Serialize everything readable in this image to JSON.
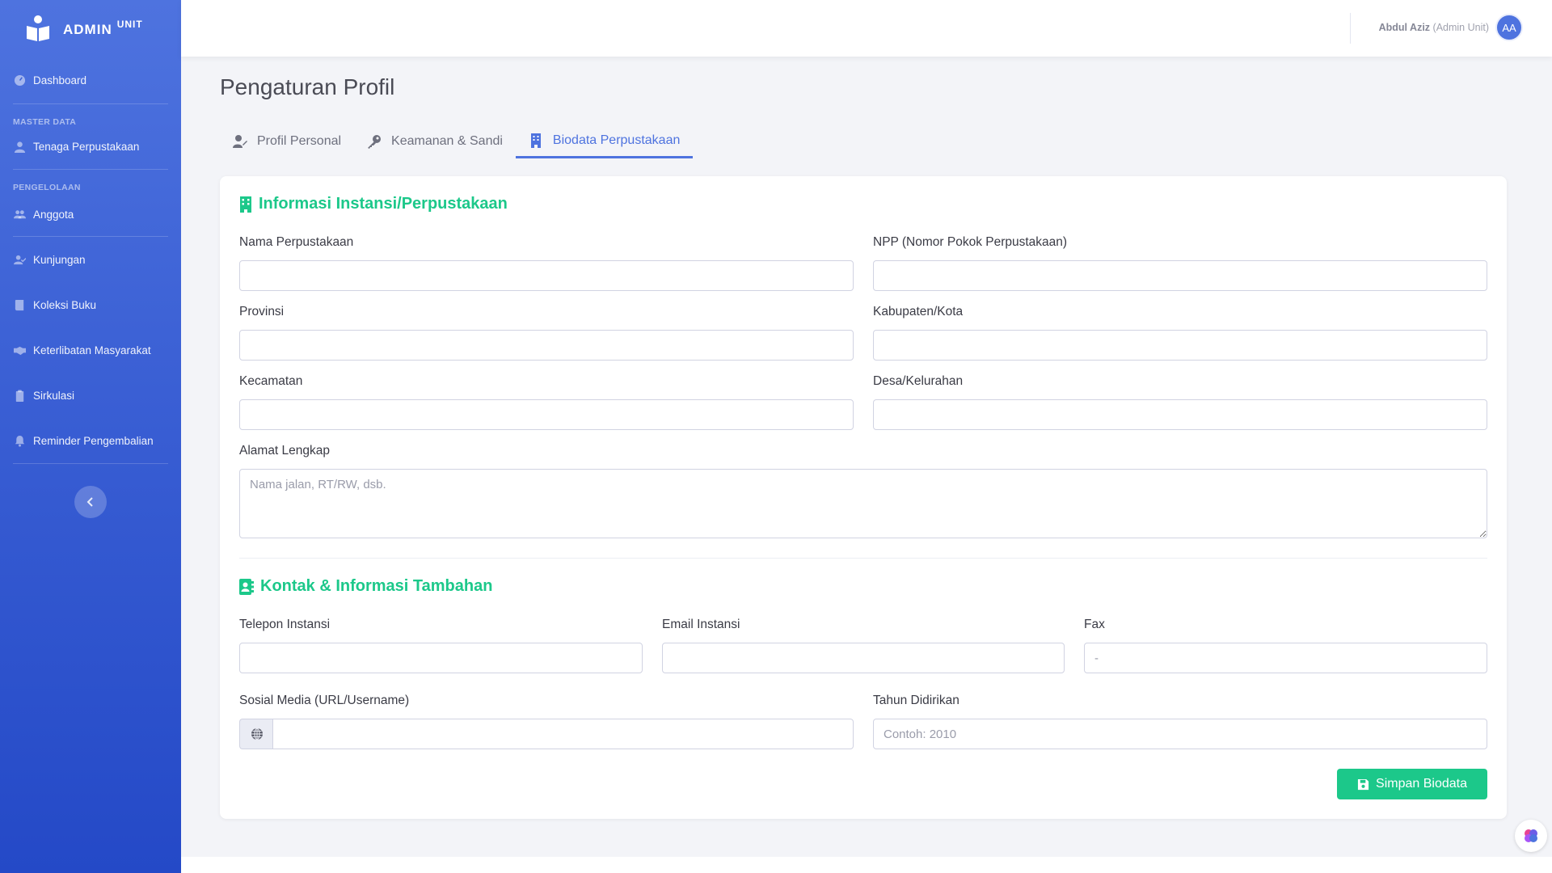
{
  "brand": {
    "name": "ADMIN",
    "suffix": "UNIT"
  },
  "sidebar": {
    "dashboard": "Dashboard",
    "heading_master": "MASTER DATA",
    "tenaga": "Tenaga Perpustakaan",
    "heading_pengelolaan": "PENGELOLAAN",
    "items": [
      {
        "label": "Anggota",
        "icon": "users-icon"
      },
      {
        "label": "Kunjungan",
        "icon": "user-check-icon"
      },
      {
        "label": "Koleksi Buku",
        "icon": "book-icon"
      },
      {
        "label": "Keterlibatan Masyarakat",
        "icon": "handshake-icon"
      },
      {
        "label": "Sirkulasi",
        "icon": "clipboard-icon"
      },
      {
        "label": "Reminder Pengembalian",
        "icon": "bell-icon"
      }
    ]
  },
  "user": {
    "name": "Abdul Aziz",
    "role": "(Admin Unit)",
    "initials": "AA"
  },
  "page": {
    "title": "Pengaturan Profil"
  },
  "tabs": {
    "personal": "Profil Personal",
    "security": "Keamanan & Sandi",
    "biodata": "Biodata Perpustakaan"
  },
  "section1": {
    "title": "Informasi Instansi/Perpustakaan",
    "nama_label": "Nama Perpustakaan",
    "npp_label": "NPP (Nomor Pokok Perpustakaan)",
    "provinsi_label": "Provinsi",
    "kabupaten_label": "Kabupaten/Kota",
    "kecamatan_label": "Kecamatan",
    "desa_label": "Desa/Kelurahan",
    "alamat_label": "Alamat Lengkap",
    "alamat_placeholder": "Nama jalan, RT/RW, dsb."
  },
  "section2": {
    "title": "Kontak & Informasi Tambahan",
    "telepon_label": "Telepon Instansi",
    "email_label": "Email Instansi",
    "fax_label": "Fax",
    "fax_value": "-",
    "sosmed_label": "Sosial Media (URL/Username)",
    "tahun_label": "Tahun Didirikan",
    "tahun_placeholder": "Contoh: 2010"
  },
  "actions": {
    "save": "Simpan Biodata"
  },
  "colors": {
    "primary": "#4e73df",
    "success": "#1cc88a"
  }
}
